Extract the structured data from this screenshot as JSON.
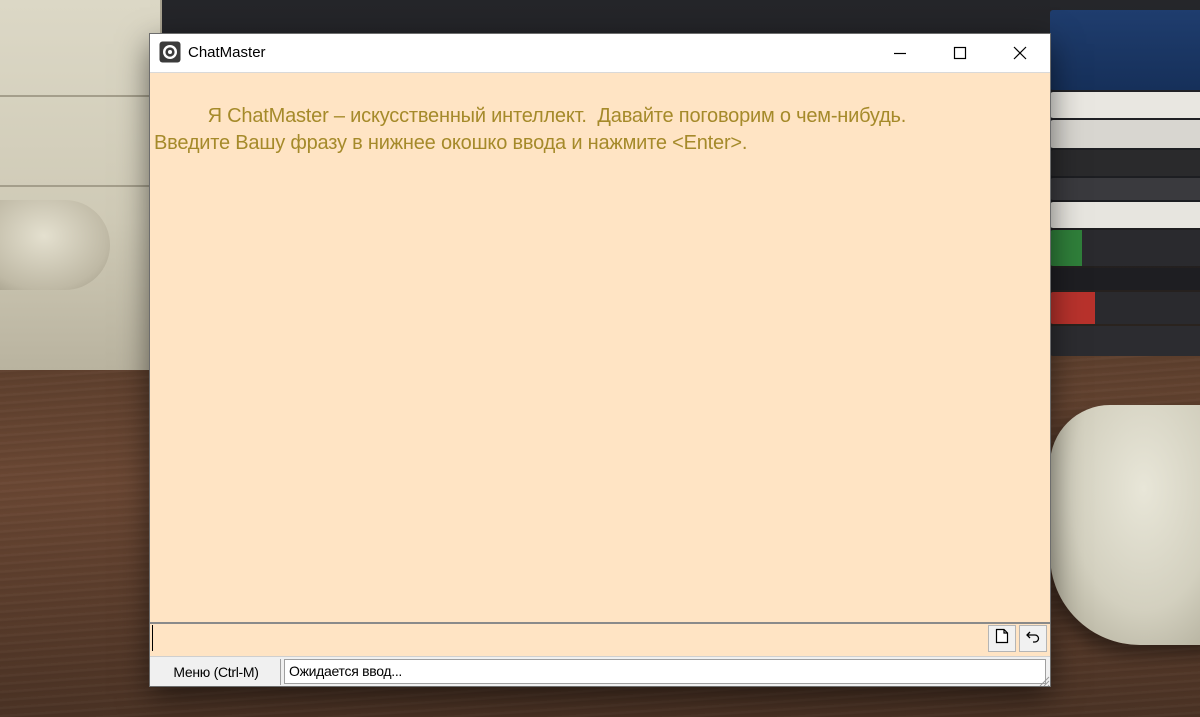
{
  "window": {
    "title": "ChatMaster"
  },
  "titlebar_controls": {
    "minimize_icon": "minimize-icon",
    "maximize_icon": "maximize-icon",
    "close_icon": "close-icon"
  },
  "chat": {
    "lines": [
      "          Я ChatMaster – искусственный интеллект.  Давайте поговорим о чем-нибудь.",
      "Введите Вашу фразу в нижнее окошко ввода и нажмите <Enter>."
    ]
  },
  "input": {
    "value": "",
    "new_icon": "new-document-icon",
    "undo_icon": "undo-icon"
  },
  "status": {
    "menu_label": "Меню (Ctrl-M)",
    "status_text": "Ожидается ввод..."
  },
  "colors": {
    "chat_background": "#ffe4c4",
    "chat_text": "#a58a2a"
  }
}
